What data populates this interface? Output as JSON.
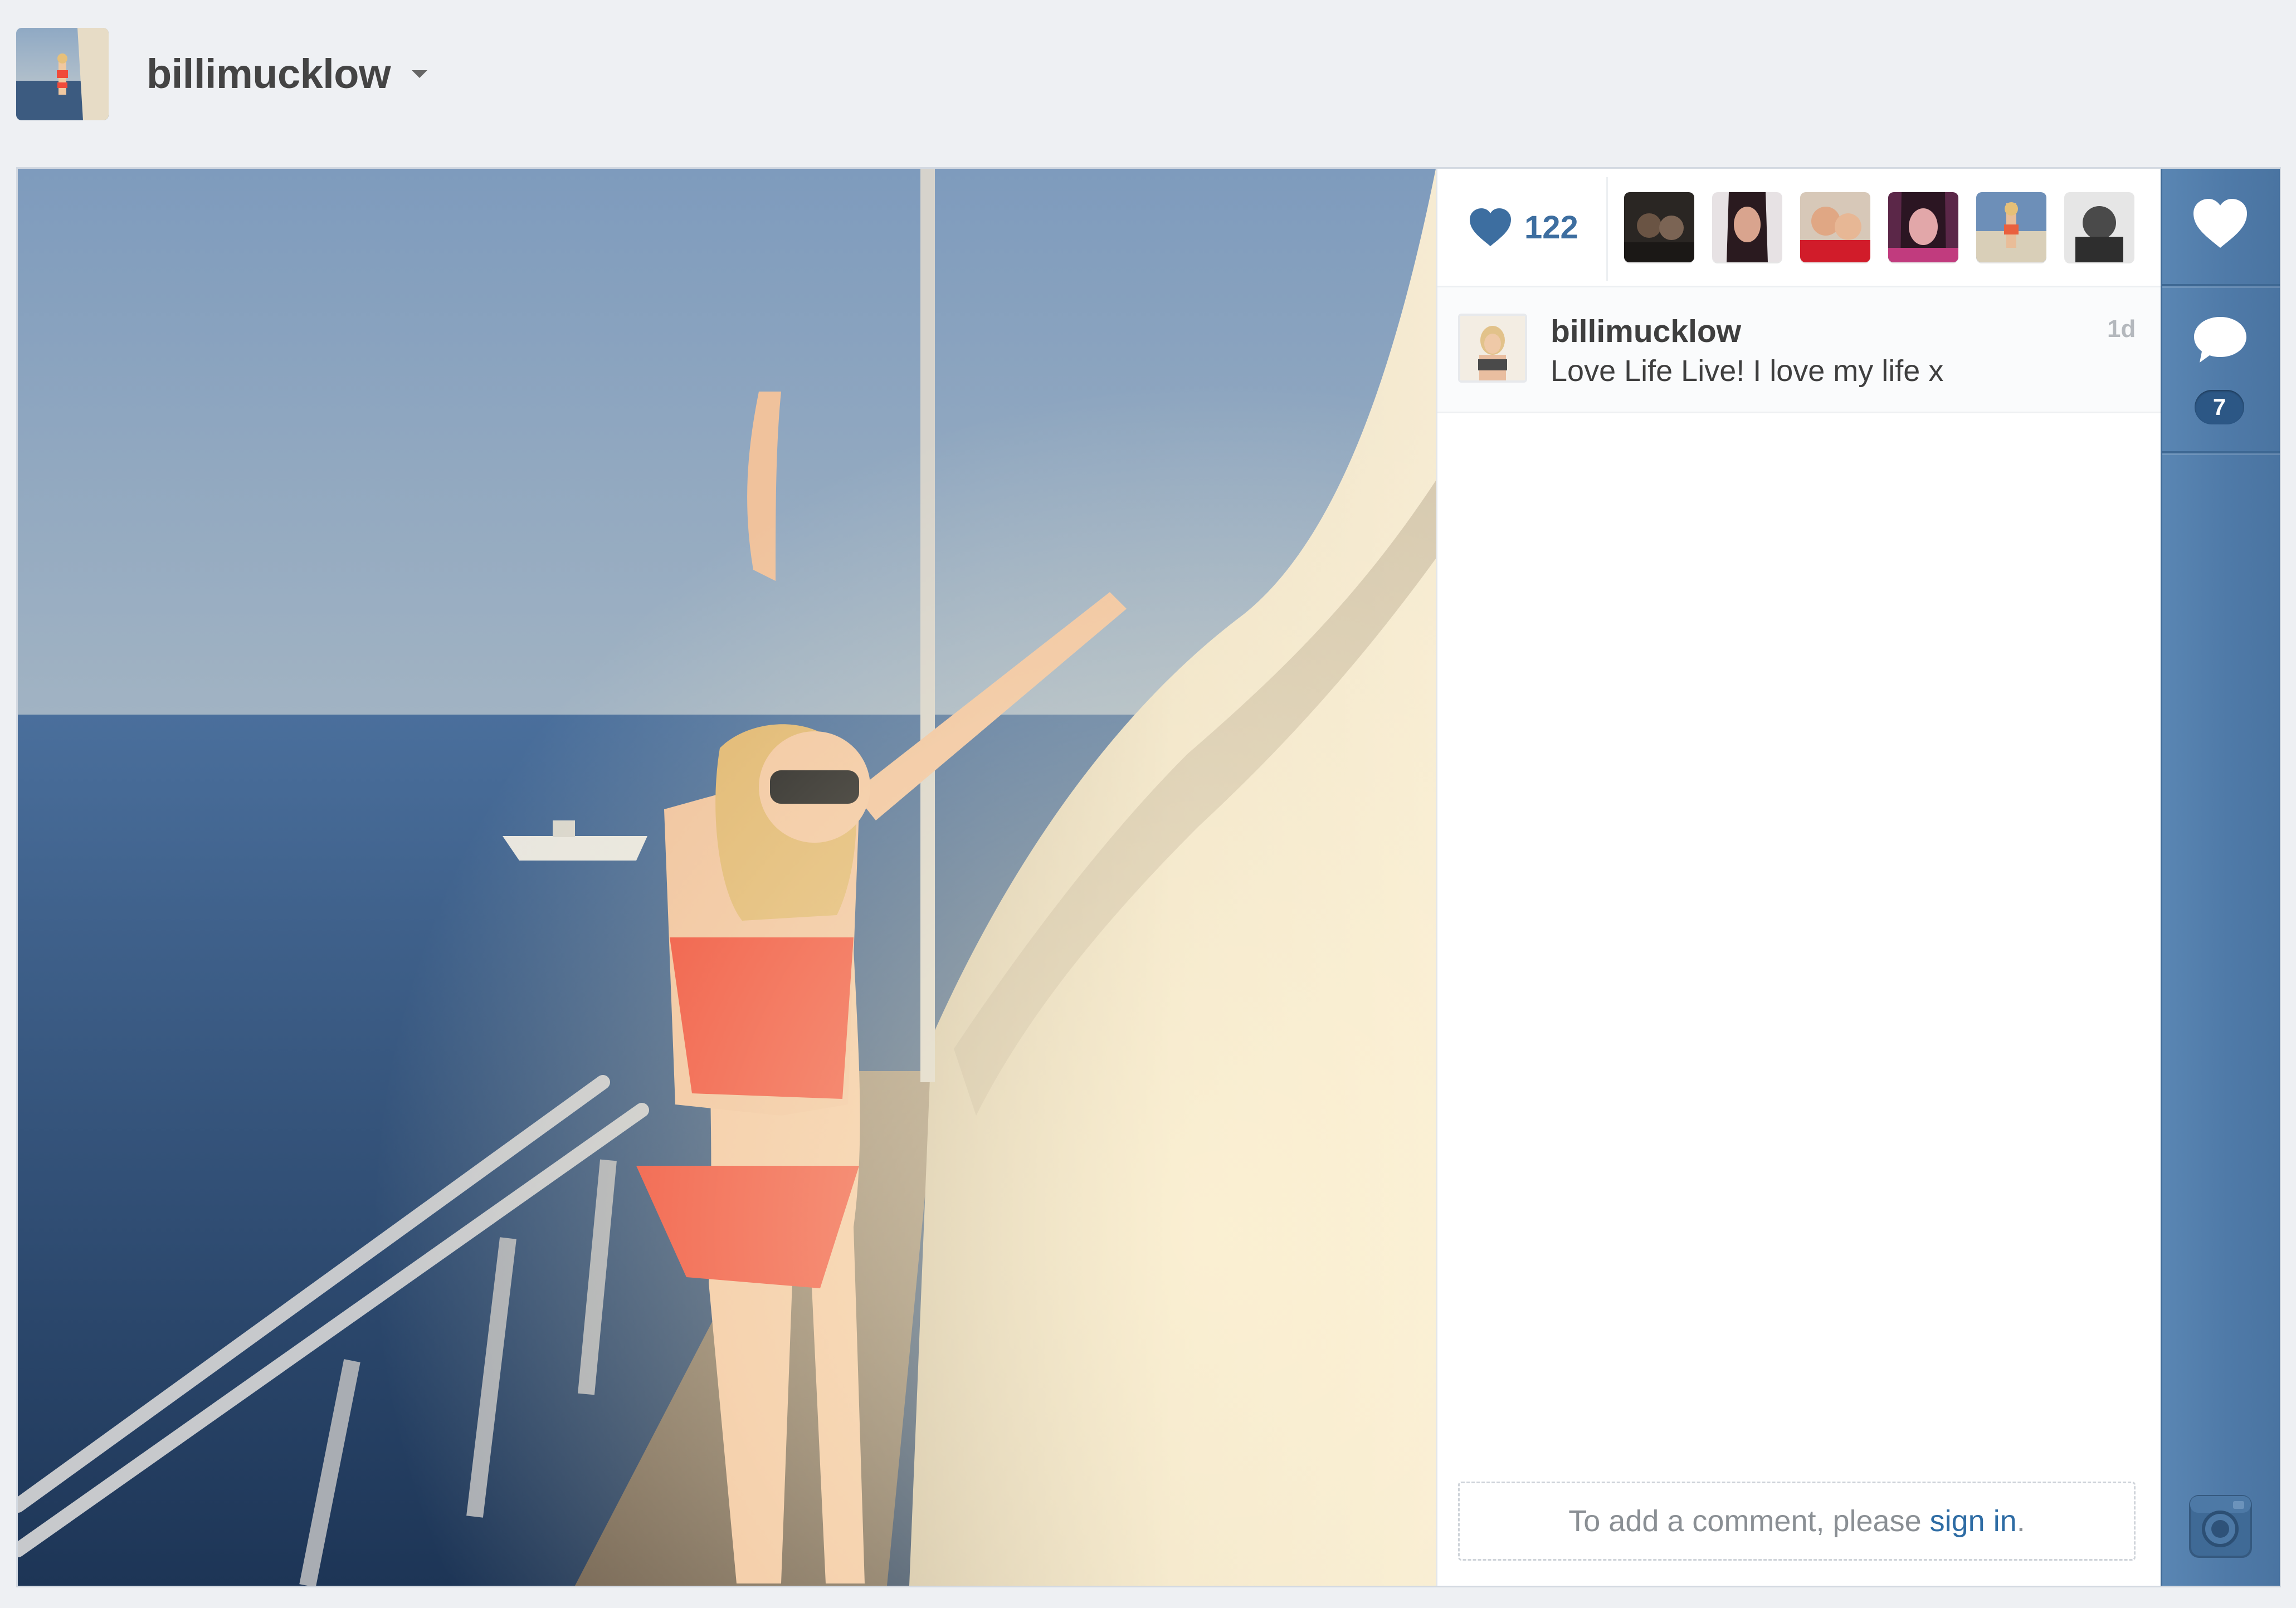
{
  "header": {
    "username": "billimucklow",
    "avatar": "profile-avatar"
  },
  "post": {
    "like_count": "122",
    "likers": [
      "liker-avatar-1",
      "liker-avatar-2",
      "liker-avatar-3",
      "liker-avatar-4",
      "liker-avatar-5",
      "liker-avatar-6"
    ],
    "caption": {
      "username": "billimucklow",
      "text": "Love Life Live! I love my life x",
      "time": "1d"
    },
    "comment_prompt": {
      "prefix": "To add a comment, please ",
      "link": "sign in",
      "suffix": "."
    }
  },
  "rail": {
    "comment_count": "7",
    "icons": [
      "heart-icon",
      "comment-bubble-icon",
      "instagram-camera-icon"
    ]
  },
  "colors": {
    "accent_blue": "#3d6ea0",
    "rail_blue": "#4f7aa8",
    "link_blue": "#2e6ca4"
  }
}
